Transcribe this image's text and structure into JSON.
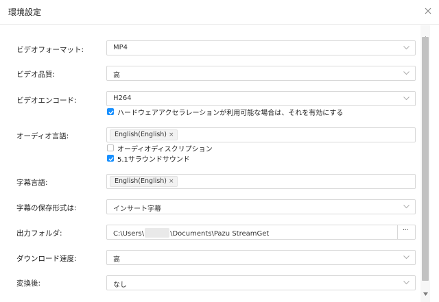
{
  "dialog": {
    "title": "環境設定"
  },
  "settings": {
    "video_format": {
      "label": "ビデオフォーマット:",
      "value": "MP4"
    },
    "video_quality": {
      "label": "ビデオ品質:",
      "value": "高"
    },
    "video_encode": {
      "label": "ビデオエンコード:",
      "value": "H264",
      "hw_accel_label": "ハードウェアアクセラレーションが利用可能な場合は、それを有効にする",
      "hw_accel_checked": true
    },
    "audio_language": {
      "label": "オーディオ言語:",
      "tag": "English(English)",
      "tag_remove": "×",
      "audio_description_label": "オーディオディスクリプション",
      "audio_description_checked": false,
      "surround_label": "5.1サラウンドサウンド",
      "surround_checked": true
    },
    "subtitle_language": {
      "label": "字幕言語:",
      "tag": "English(English)",
      "tag_remove": "×"
    },
    "subtitle_format": {
      "label": "字幕の保存形式は:",
      "value": "インサート字幕"
    },
    "output_folder": {
      "label": "出力フォルダ:",
      "path_prefix": "C:\\Users\\",
      "path_suffix": "\\Documents\\Pazu StreamGet",
      "browse_label": "···"
    },
    "download_speed": {
      "label": "ダウンロード速度:",
      "value": "高"
    },
    "after_convert": {
      "label": "変換後:",
      "value": "なし"
    }
  },
  "icons": {
    "close": "close-icon",
    "dropdown": "chevron-down-icon",
    "check": "check-icon"
  },
  "colors": {
    "accent": "#1890ff",
    "border": "#d8d8d8",
    "scrollbar_thumb": "#c1c1c1"
  }
}
